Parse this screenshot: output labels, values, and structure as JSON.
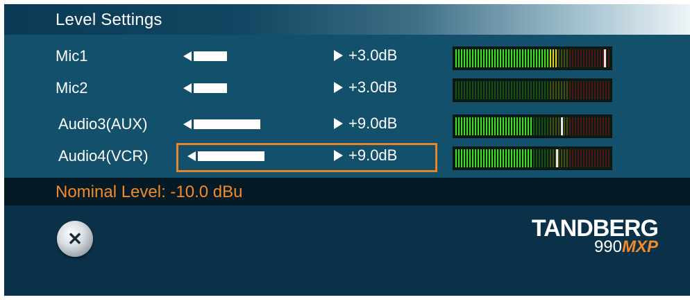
{
  "window": {
    "title": "Level Settings"
  },
  "rows": [
    {
      "label": "Mic1",
      "value": "+3.0dB",
      "meter_level": 0.66,
      "meter_peak": 0.97
    },
    {
      "label": "Mic2",
      "value": "+3.0dB",
      "meter_level": 0.0,
      "meter_peak": null
    },
    {
      "label": "Audio3(AUX)",
      "value": "+9.0dB",
      "meter_level": 0.5,
      "meter_peak": 0.69
    },
    {
      "label": "Audio4(VCR)",
      "value": "+9.0dB",
      "meter_level": 0.5,
      "meter_peak": 0.66,
      "selected": true
    }
  ],
  "status": {
    "nominal_level": "Nominal Level: -10.0 dBu"
  },
  "brand": {
    "name": "TANDBERG",
    "model_number": "990",
    "model_suffix": "MXP"
  },
  "icons": {
    "close": "close-icon"
  },
  "colors": {
    "panel": "#13506b",
    "nominal_text": "#f28a2a",
    "focus": "#e4862a",
    "meter_green": "#3fe01a",
    "meter_yellow": "#e3d21c",
    "meter_red": "#8a1414"
  }
}
